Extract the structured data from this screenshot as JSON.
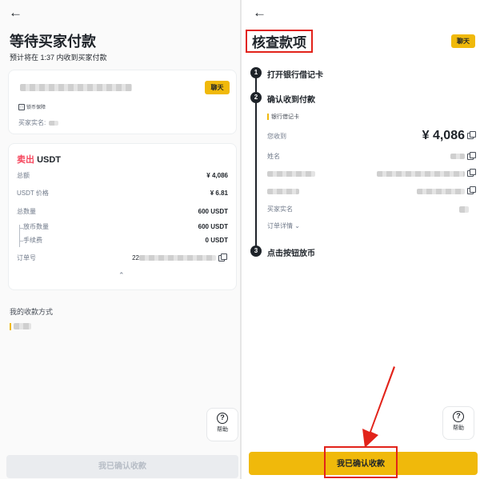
{
  "left": {
    "title": "等待买家付款",
    "subtitle": "预计将在 1:37 内收到买家付款",
    "buyer_card": {
      "chat_label": "聊天",
      "badge_label": "锁币保障",
      "buyer_name_label": "买家实名:"
    },
    "order_card": {
      "action_label": "卖出",
      "asset": "USDT",
      "rows": [
        {
          "label": "总额",
          "value": "¥ 4,086"
        },
        {
          "label": "USDT 价格",
          "value": "¥ 6.81"
        },
        {
          "label": "总数量",
          "value": "600 USDT"
        },
        {
          "label": "放币数量",
          "value": "600 USDT"
        },
        {
          "label": "手续费",
          "value": "0 USDT"
        },
        {
          "label": "订单号",
          "value": "22"
        }
      ]
    },
    "payment_methods_label": "我的收款方式",
    "help_label": "帮助",
    "confirm_button": "我已确认收款"
  },
  "right": {
    "title": "核查款项",
    "chat_label": "聊天",
    "steps": [
      {
        "num": "1",
        "label": "打开银行借记卡"
      },
      {
        "num": "2",
        "label": "确认收到付款"
      },
      {
        "num": "3",
        "label": "点击按钮放币"
      }
    ],
    "bank_tag": "银行借记卡",
    "received_label": "您收到",
    "received_amount": "¥ 4,086",
    "name_label": "姓名",
    "buyer_name_label": "买家实名",
    "order_detail_label": "订单详情",
    "help_label": "帮助",
    "confirm_button": "我已确认收款"
  },
  "colors": {
    "accent": "#f0b90b",
    "sell_red": "#f6465d",
    "annotation_red": "#e2231a"
  }
}
